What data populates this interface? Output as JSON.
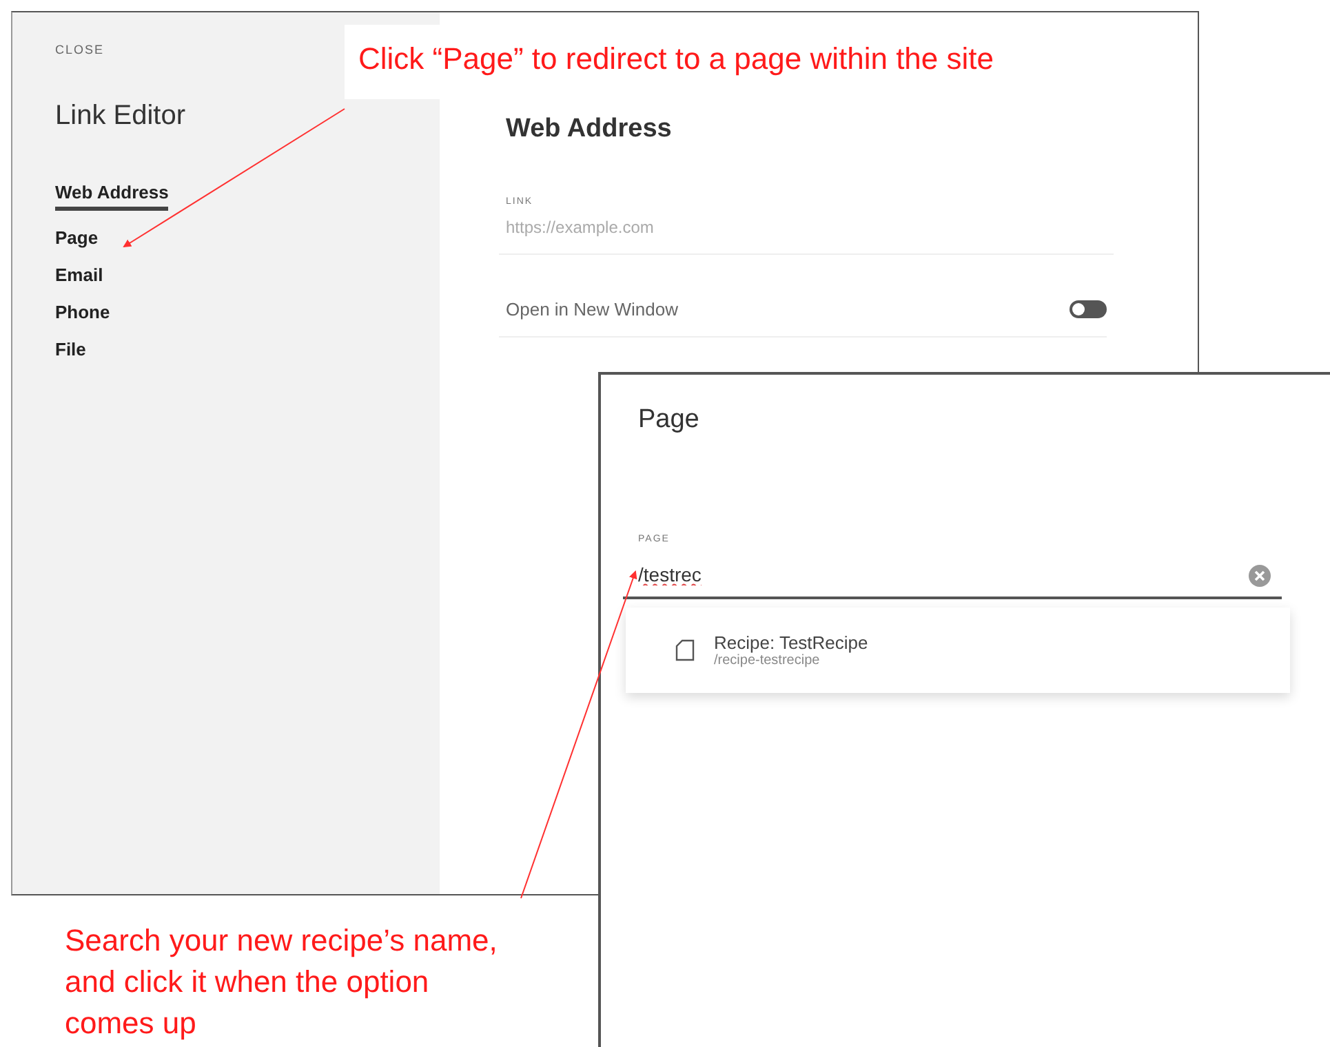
{
  "link_editor": {
    "close": "CLOSE",
    "title": "Link Editor",
    "nav": [
      {
        "label": "Web Address",
        "selected": true
      },
      {
        "label": "Page",
        "selected": false
      },
      {
        "label": "Email",
        "selected": false
      },
      {
        "label": "Phone",
        "selected": false
      },
      {
        "label": "File",
        "selected": false
      }
    ]
  },
  "web_address": {
    "title": "Web Address",
    "field_label": "LINK",
    "placeholder": "https://example.com",
    "toggle_label": "Open in New Window",
    "toggle_on": false
  },
  "page_dialog": {
    "title": "Page",
    "field_label": "PAGE",
    "value": "/testrec",
    "results": [
      {
        "title": "Recipe: TestRecipe",
        "path": "/recipe-testrecipe"
      }
    ]
  },
  "annotations": [
    {
      "text": "Click “Page” to redirect to a page within the site"
    },
    {
      "text": "Search your new recipe’s name, and click it when the option comes up"
    }
  ]
}
